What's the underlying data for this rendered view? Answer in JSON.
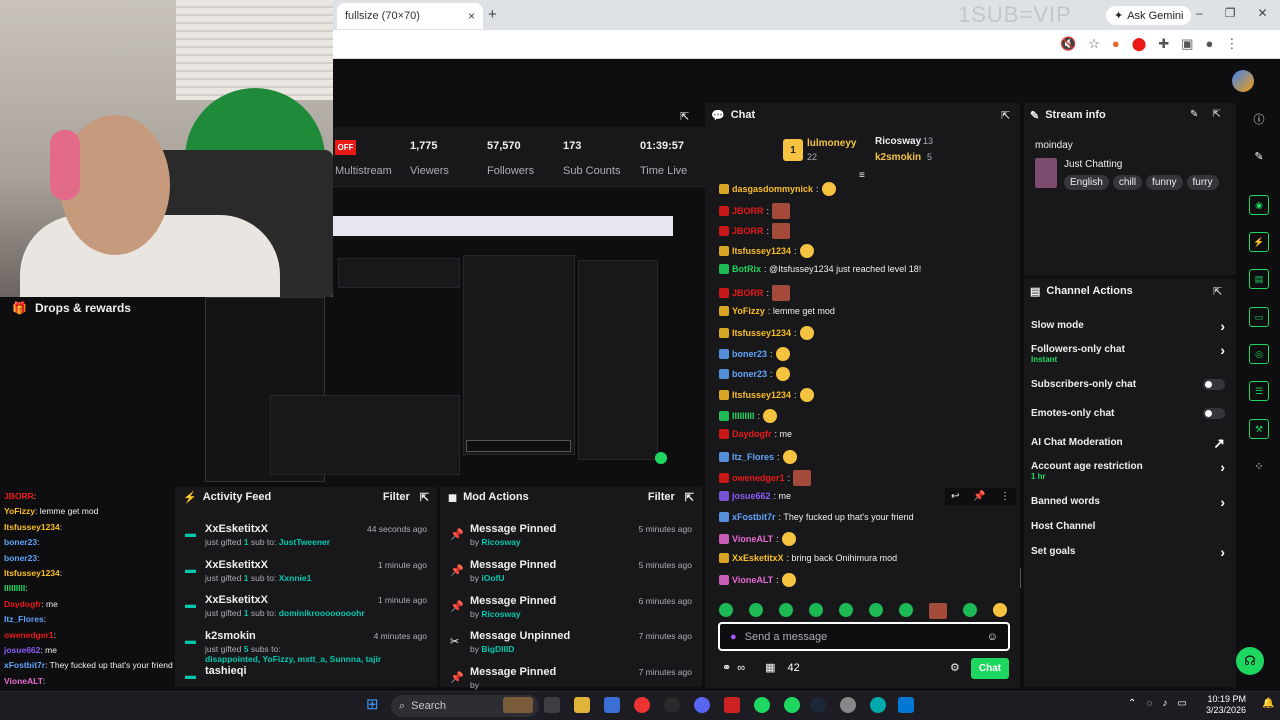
{
  "browser": {
    "tab_title": "fullsize (70×70)",
    "tab_close": "×",
    "new_tab": "+",
    "overlay_text": "1SUB=VIP",
    "gemini_label": "Ask Gemini",
    "win_min": "–",
    "win_max": "❐",
    "win_close": "✕"
  },
  "stats": {
    "off_badge": "OFF",
    "multistream": "Multistream",
    "items": [
      {
        "value": "1,775",
        "label": "Viewers"
      },
      {
        "value": "57,570",
        "label": "Followers"
      },
      {
        "value": "173",
        "label": "Sub Counts"
      },
      {
        "value": "01:39:57",
        "label": "Time Live"
      }
    ]
  },
  "drops": {
    "title": "Drops & rewards"
  },
  "left_chat": [
    {
      "user": "JBORR",
      "text": ":",
      "color": "#e91916"
    },
    {
      "user": "YoFizzy",
      "text": ": lemme get mod",
      "color": "#fbbf24"
    },
    {
      "user": "Itsfussey1234",
      "text": ":",
      "color": "#fbbf24"
    },
    {
      "user": "boner23",
      "text": ":",
      "color": "#60a5fa"
    },
    {
      "user": "boner23",
      "text": ":",
      "color": "#60a5fa"
    },
    {
      "user": "Itsfussey1234",
      "text": ":",
      "color": "#fbbf24"
    },
    {
      "user": "IIIIIIIII",
      "text": ":",
      "color": "#1ed760"
    },
    {
      "user": "Daydogfr",
      "text": ": me",
      "color": "#e91916"
    },
    {
      "user": "Itz_Flores",
      "text": ":",
      "color": "#60a5fa"
    },
    {
      "user": "owenedger1",
      "text": ":",
      "color": "#e91916"
    },
    {
      "user": "josue662",
      "text": ": me",
      "color": "#8b5cf6"
    },
    {
      "user": "xFostbit7r",
      "text": ": They fucked up that's your friend",
      "color": "#60a5fa"
    },
    {
      "user": "VioneALT",
      "text": ":",
      "color": "#e86ad3"
    }
  ],
  "activity_feed": {
    "title": "Activity Feed",
    "filter": "Filter",
    "items": [
      {
        "name": "XxEsketitxX",
        "pre": "just gifted ",
        "n": "1",
        "mid": " sub to: ",
        "target": "JustTweener",
        "time": "44 seconds ago"
      },
      {
        "name": "XxEsketitxX",
        "pre": "just gifted ",
        "n": "1",
        "mid": " sub to: ",
        "target": "Xxnnie1",
        "time": "1 minute ago"
      },
      {
        "name": "XxEsketitxX",
        "pre": "just gifted ",
        "n": "1",
        "mid": " sub to: ",
        "target": "dominikroooooooohr",
        "time": "1 minute ago"
      },
      {
        "name": "k2smokin",
        "pre": "just gifted ",
        "n": "5",
        "mid": " subs to:",
        "target": "disappointed, YoFizzy, mxtt_a, Sunnna, tajir",
        "time": "4 minutes ago"
      },
      {
        "name": "tashieqi",
        "pre": "",
        "n": "",
        "mid": "",
        "target": "",
        "time": ""
      }
    ]
  },
  "mod_actions": {
    "title": "Mod Actions",
    "filter": "Filter",
    "items": [
      {
        "action": "Message Pinned",
        "by": "Ricosway",
        "time": "5 minutes ago",
        "icon": "pin"
      },
      {
        "action": "Message Pinned",
        "by": "iOofU",
        "time": "5 minutes ago",
        "icon": "pin"
      },
      {
        "action": "Message Pinned",
        "by": "Ricosway",
        "time": "6 minutes ago",
        "icon": "pin"
      },
      {
        "action": "Message Unpinned",
        "by": "BigDIIID",
        "time": "7 minutes ago",
        "icon": "unpin"
      },
      {
        "action": "Message Pinned",
        "by": "",
        "time": "7 minutes ago",
        "icon": "pin"
      }
    ],
    "by_prefix": "by "
  },
  "chat": {
    "title": "Chat",
    "leaders": [
      {
        "name": "lulmoneyy",
        "count": "22",
        "rank": "1"
      },
      {
        "name": "Ricosway",
        "count": "13"
      },
      {
        "name": "k2smokin",
        "count": "5"
      }
    ],
    "messages": [
      {
        "user": "dasgasdommynick",
        "text": ":",
        "color": "#fbbf24"
      },
      {
        "user": "JBORR",
        "text": ":",
        "color": "#e91916"
      },
      {
        "user": "JBORR",
        "text": ":",
        "color": "#e91916"
      },
      {
        "user": "Itsfussey1234",
        "text": ":",
        "color": "#fbbf24"
      },
      {
        "user": "BotRix",
        "text": ": @Itsfussey1234 just reached level 18!",
        "color": "#1ed760"
      },
      {
        "user": "JBORR",
        "text": ":",
        "color": "#e91916"
      },
      {
        "user": "YoFizzy",
        "text": ": lemme get mod",
        "color": "#fbbf24"
      },
      {
        "user": "Itsfussey1234",
        "text": ":",
        "color": "#fbbf24"
      },
      {
        "user": "boner23",
        "text": ":",
        "color": "#60a5fa"
      },
      {
        "user": "boner23",
        "text": ":",
        "color": "#60a5fa"
      },
      {
        "user": "Itsfussey1234",
        "text": ":",
        "color": "#fbbf24"
      },
      {
        "user": "IIIIIIIII",
        "text": ":",
        "color": "#1ed760"
      },
      {
        "user": "Daydogfr",
        "text": ": me",
        "color": "#e91916"
      },
      {
        "user": "Itz_Flores",
        "text": ":",
        "color": "#60a5fa"
      },
      {
        "user": "owenedger1",
        "text": ":",
        "color": "#e91916"
      },
      {
        "user": "josue662",
        "text": ": me",
        "color": "#8b5cf6"
      },
      {
        "user": "xFostbit7r",
        "text": ": They fucked up that's your friend",
        "color": "#60a5fa"
      },
      {
        "user": "VioneALT",
        "text": ":",
        "color": "#e86ad3"
      },
      {
        "user": "XxEsketitxX",
        "text": ": bring back Onihimura mod",
        "color": "#fbbf24"
      },
      {
        "user": "VioneALT",
        "text": ":",
        "color": "#e86ad3"
      }
    ],
    "input_placeholder": "Send a message",
    "viewer_count": "42",
    "send_label": "Chat"
  },
  "stream_info": {
    "title": "Stream info",
    "stream_title": "moinday",
    "category": "Just Chatting",
    "tags": [
      "English",
      "chill",
      "funny",
      "furry"
    ]
  },
  "channel_actions": {
    "title": "Channel Actions",
    "rows": [
      {
        "label": "Slow mode",
        "kind": "chev",
        "sub": ""
      },
      {
        "label": "Followers-only chat",
        "kind": "chev",
        "sub": "Instant"
      },
      {
        "label": "Subscribers-only chat",
        "kind": "toggle",
        "sub": ""
      },
      {
        "label": "Emotes-only chat",
        "kind": "toggle",
        "sub": ""
      },
      {
        "label": "AI Chat Moderation",
        "kind": "ext",
        "sub": ""
      },
      {
        "label": "Account age restriction",
        "kind": "chev",
        "sub": "1 hr"
      },
      {
        "label": "Banned words",
        "kind": "chev",
        "sub": ""
      },
      {
        "label": "Host Channel",
        "kind": "none",
        "sub": ""
      },
      {
        "label": "Set goals",
        "kind": "chev",
        "sub": ""
      }
    ]
  },
  "taskbar": {
    "search_placeholder": "Search",
    "time": "10:19 PM",
    "date": "3/23/2026"
  },
  "colors": {
    "accent": "#1ed760",
    "live_red": "#e91916",
    "panel": "#18181b",
    "bg": "#0e0e10"
  }
}
